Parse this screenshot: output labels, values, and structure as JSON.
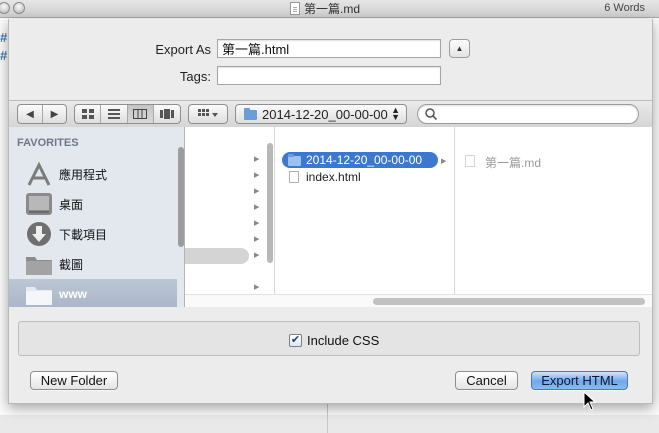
{
  "window": {
    "title": "第一篇.md",
    "word_count": "6 Words"
  },
  "dialog": {
    "export_as_label": "Export As",
    "export_as_value": "第一篇.html",
    "tags_label": "Tags:",
    "tags_value": "",
    "current_folder": "2014-12-20_00-00-00",
    "search_placeholder": ""
  },
  "sidebar": {
    "heading": "FAVORITES",
    "items": [
      {
        "label": "應用程式",
        "icon": "applications-icon"
      },
      {
        "label": "桌面",
        "icon": "desktop-icon"
      },
      {
        "label": "下載項目",
        "icon": "downloads-icon"
      },
      {
        "label": "截圖",
        "icon": "folder-icon"
      },
      {
        "label": "www",
        "icon": "folder-icon",
        "selected": true
      }
    ]
  },
  "browser": {
    "column2": [
      {
        "name": "2014-12-20_00-00-00",
        "type": "folder",
        "selected": true
      },
      {
        "name": "index.html",
        "type": "file"
      }
    ],
    "column3": [
      {
        "name": "第一篇.md",
        "type": "file",
        "dimmed": true
      }
    ]
  },
  "options": {
    "include_css_label": "Include CSS",
    "include_css_checked": true
  },
  "buttons": {
    "new_folder": "New Folder",
    "cancel": "Cancel",
    "export": "Export HTML"
  },
  "colors": {
    "selection": "#3c78d0",
    "default_button": "#6fa7ec",
    "sidebar_bg": "#e3e8ee"
  }
}
